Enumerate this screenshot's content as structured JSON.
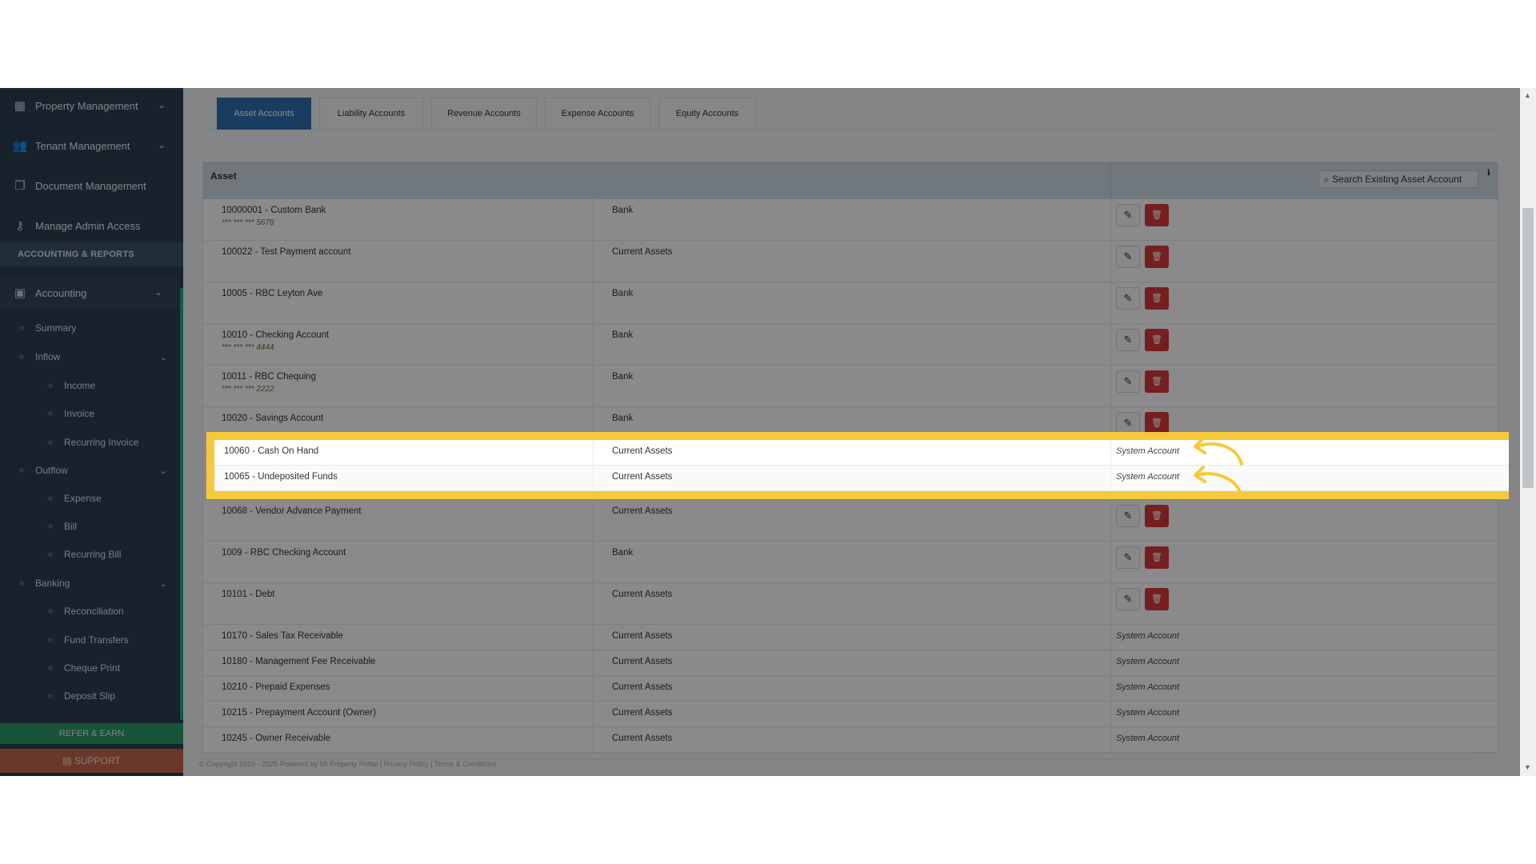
{
  "sidebar": {
    "items_top": [
      {
        "label": "Property Management",
        "icon": "building-icon"
      },
      {
        "label": "Tenant Management",
        "icon": "users-icon"
      },
      {
        "label": "Document Management",
        "icon": "documents-icon"
      },
      {
        "label": "Manage Admin Access",
        "icon": "key-icon"
      }
    ],
    "section_label": "ACCOUNTING & REPORTS",
    "accounting_label": "Accounting",
    "sub": {
      "summary": "Summary",
      "inflow": "Inflow",
      "income": "Income",
      "invoice": "Invoice",
      "recurring_invoice": "Recurring Invoice",
      "outflow": "Outflow",
      "expense": "Expense",
      "bill": "Bill",
      "recurring_bill": "Recurring Bill",
      "banking": "Banking",
      "reconciliation": "Reconciliation",
      "fund_transfers": "Fund Transfers",
      "cheque_print": "Cheque Print",
      "deposit_slip": "Deposit Slip"
    },
    "refer_label": "REFER & EARN",
    "support_label": "SUPPORT"
  },
  "tabs": [
    "Asset Accounts",
    "Liability Accounts",
    "Revenue Accounts",
    "Expense Accounts",
    "Equity Accounts"
  ],
  "panel": {
    "title": "Asset",
    "search_placeholder": "Search Existing Asset Account"
  },
  "rows": [
    {
      "account": "10000001 - Custom Bank",
      "mask": "*** *** *** 5678",
      "type": "Bank",
      "action": "buttons"
    },
    {
      "account": "100022 - Test Payment account",
      "mask": "",
      "type": "Current Assets",
      "action": "buttons"
    },
    {
      "account": "10005 - RBC Leyton Ave",
      "mask": "",
      "type": "Bank",
      "action": "buttons"
    },
    {
      "account": "10010 - Checking Account",
      "mask": "*** *** *** 4444",
      "type": "Bank",
      "action": "buttons"
    },
    {
      "account": "10011 - RBC Chequing",
      "mask": "*** *** *** 2222",
      "type": "Bank",
      "action": "buttons"
    },
    {
      "account": "10020 - Savings Account",
      "mask": "",
      "type": "Bank",
      "action": "buttons"
    },
    {
      "account": "10060 - Cash On Hand",
      "mask": "",
      "type": "Current Assets",
      "action": "System Account"
    },
    {
      "account": "10065 - Undeposited Funds",
      "mask": "",
      "type": "Current Assets",
      "action": "System Account"
    },
    {
      "account": "10068 - Vendor Advance Payment",
      "mask": "",
      "type": "Current Assets",
      "action": "buttons"
    },
    {
      "account": "1009 - RBC Checking Account",
      "mask": "",
      "type": "Bank",
      "action": "buttons"
    },
    {
      "account": "10101 - Debt",
      "mask": "",
      "type": "Current Assets",
      "action": "buttons"
    },
    {
      "account": "10170 - Sales Tax Receivable",
      "mask": "",
      "type": "Current Assets",
      "action": "System Account"
    },
    {
      "account": "10180 - Management Fee Receivable",
      "mask": "",
      "type": "Current Assets",
      "action": "System Account"
    },
    {
      "account": "10210 - Prepaid Expenses",
      "mask": "",
      "type": "Current Assets",
      "action": "System Account"
    },
    {
      "account": "10215 - Prepayment Account (Owner)",
      "mask": "",
      "type": "Current Assets",
      "action": "System Account"
    },
    {
      "account": "10245 - Owner Receivable",
      "mask": "",
      "type": "Current Assets",
      "action": "System Account"
    }
  ],
  "footer": "© Copyright 2015 - 2025 Powered by MI Property Portal | Privacy Policy | Terms & Conditions",
  "colors": {
    "highlight": "#f7c93a",
    "active_tab": "#2f72b4",
    "delete": "#d83a3a"
  }
}
